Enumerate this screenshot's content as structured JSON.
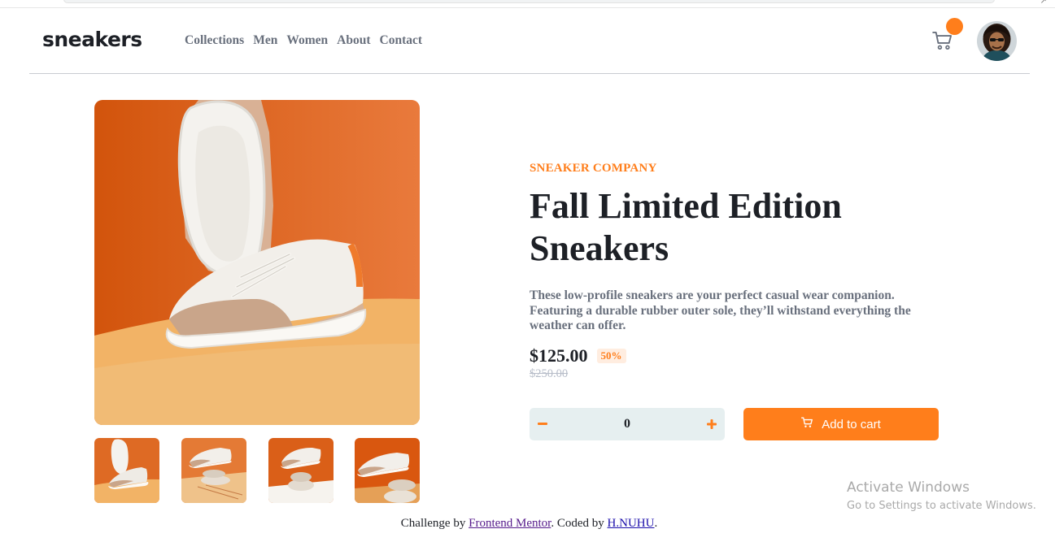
{
  "brand": {
    "logo": "sneakers"
  },
  "nav": [
    {
      "label": "Collections"
    },
    {
      "label": "Men"
    },
    {
      "label": "Women"
    },
    {
      "label": "About"
    },
    {
      "label": "Contact"
    }
  ],
  "product": {
    "company": "SNEAKER COMPANY",
    "title": "Fall Limited Edition Sneakers",
    "description": "These low-profile sneakers are your perfect casual wear companion. Featuring a durable rubber outer sole, they’ll withstand everything the weather can offer.",
    "price": "$125.00",
    "discount": "50%",
    "old_price": "$250.00",
    "quantity": "0",
    "add_to_cart_label": "Add to cart"
  },
  "icons": {
    "cart": "cart-icon",
    "minus": "minus-icon",
    "plus": "plus-icon"
  },
  "colors": {
    "accent": "#ff7e1b",
    "accent_pale": "#ffede0",
    "dark": "#1d2026",
    "grey_text": "#69707d",
    "qty_bg": "#e6eff0"
  },
  "watermark": {
    "title": "Activate Windows",
    "subtitle": "Go to Settings to activate Windows."
  },
  "attribution": {
    "prefix": "Challenge by ",
    "link1": "Frontend Mentor",
    "middle": ". Coded by ",
    "link2": "H.NUHU",
    "suffix": "."
  }
}
